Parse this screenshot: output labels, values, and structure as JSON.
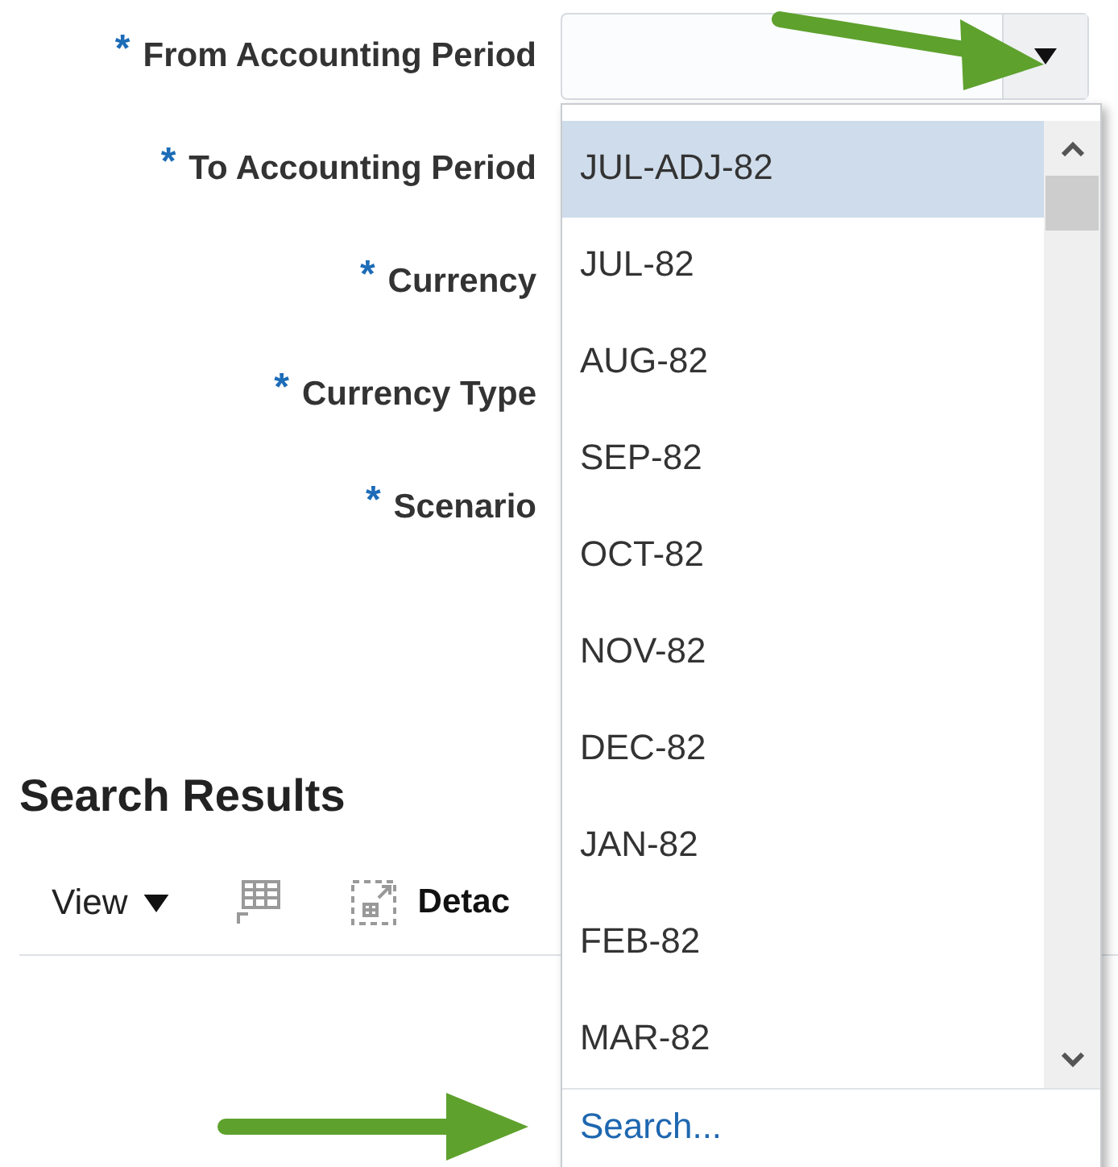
{
  "form": {
    "fields": [
      {
        "required_mark": "*",
        "label": "From Accounting Period",
        "kind": "select"
      },
      {
        "required_mark": "*",
        "label": "To Accounting Period",
        "kind": "hidden"
      },
      {
        "required_mark": "*",
        "label": "Currency",
        "kind": "hidden"
      },
      {
        "required_mark": "*",
        "label": "Currency Type",
        "kind": "hidden"
      },
      {
        "required_mark": "*",
        "label": "Scenario",
        "kind": "hidden"
      }
    ]
  },
  "search_results": {
    "title": "Search Results",
    "toolbar": [
      {
        "kind": "menu",
        "label": "View"
      },
      {
        "kind": "icon"
      },
      {
        "kind": "detach",
        "label": "Detac"
      }
    ]
  },
  "dropdown": {
    "options": [
      {
        "label": "JUL-ADJ-82",
        "selected": true
      },
      {
        "label": "JUL-82",
        "selected": false
      },
      {
        "label": "AUG-82",
        "selected": false
      },
      {
        "label": "SEP-82",
        "selected": false
      },
      {
        "label": "OCT-82",
        "selected": false
      },
      {
        "label": "NOV-82",
        "selected": false
      },
      {
        "label": "DEC-82",
        "selected": false
      },
      {
        "label": "JAN-82",
        "selected": false
      },
      {
        "label": "FEB-82",
        "selected": false
      },
      {
        "label": "MAR-82",
        "selected": false
      }
    ],
    "footer_link": "Search..."
  }
}
